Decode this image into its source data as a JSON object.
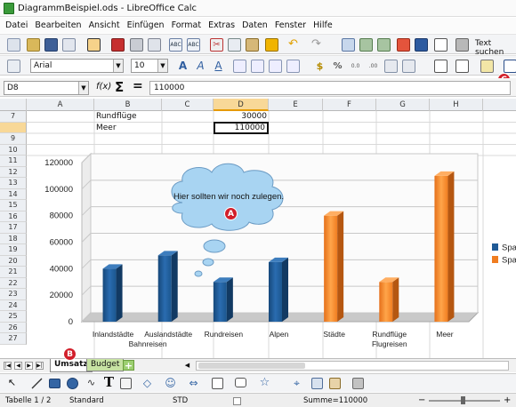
{
  "window": {
    "title": "DiagrammBeispiel.ods - LibreOffice Calc"
  },
  "menu": [
    "Datei",
    "Bearbeiten",
    "Ansicht",
    "Einfügen",
    "Format",
    "Extras",
    "Daten",
    "Fenster",
    "Hilfe"
  ],
  "toolbar": {
    "search_label": "Text suchen",
    "font_name": "Arial",
    "font_size": "10"
  },
  "formula": {
    "name_box": "D8",
    "fx": "f(x)",
    "sum": "Σ",
    "equals": "=",
    "content": "110000"
  },
  "columns": [
    "A",
    "B",
    "C",
    "D",
    "E",
    "F",
    "G",
    "H"
  ],
  "rows": [
    "7",
    "8",
    "9",
    "10",
    "11",
    "12",
    "13",
    "14",
    "15",
    "16",
    "17",
    "18",
    "19",
    "20",
    "21",
    "22",
    "23",
    "24",
    "25",
    "26",
    "27"
  ],
  "cells": {
    "b7": "Rundflüge",
    "d7": "30000",
    "b8": "Meer",
    "d8": "110000"
  },
  "callouts": {
    "a": "A",
    "b": "B",
    "c": "C"
  },
  "chart_data": {
    "type": "bar",
    "categories": [
      "Inlandstädte",
      "Auslandstädte",
      "Rundreisen",
      "Alpen",
      "Städte",
      "Rundflüge",
      "Meer"
    ],
    "category_group_labels": [
      "Bahnreisen",
      "Flugreisen"
    ],
    "series": [
      {
        "name": "Spa",
        "color": "#1f5a96",
        "values": [
          40000,
          50000,
          30000,
          45000,
          null,
          null,
          null
        ]
      },
      {
        "name": "Spa",
        "color": "#f07d20",
        "values": [
          null,
          null,
          null,
          null,
          80000,
          30000,
          110000
        ]
      }
    ],
    "yticks": [
      "0",
      "20000",
      "40000",
      "60000",
      "80000",
      "100000",
      "120000"
    ],
    "ylim": [
      0,
      120000
    ],
    "annotation": "Hier sollten wir noch zulegen.",
    "legend": "right"
  },
  "sheets": [
    {
      "name": "Umsatz",
      "active": true
    },
    {
      "name": "Budget",
      "active": false
    }
  ],
  "status": {
    "sheet": "Tabelle 1 / 2",
    "style": "Standard",
    "mode": "STD",
    "sum": "Summe=110000"
  }
}
